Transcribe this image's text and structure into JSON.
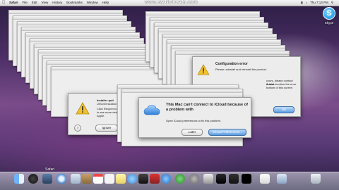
{
  "watermark": {
    "prefix": "www.",
    "brand": "BANDICAM",
    "suffix": ".com"
  },
  "menubar": {
    "apple_icon": "apple-logo-icon",
    "app_name": "Safari",
    "items": [
      "File",
      "Edit",
      "View",
      "History",
      "Bookmarks",
      "Window",
      "Help"
    ],
    "clock": "Thu 7:13 PM"
  },
  "desktop_icon": {
    "label": "Skype",
    "glyph": "S",
    "icon": "skype-icon"
  },
  "installer_dialog": {
    "title": "Installer quit",
    "line1": "UIScreenization",
    "body": [
      "Click Reopen to",
      "to see more deta",
      "Apple."
    ],
    "help": "?",
    "ignore_label": "Ignore"
  },
  "config_dialog": {
    "title": "Configuration error",
    "line1": "Please uninstall and reinstall the product.",
    "fragments": [
      "ccurs, please contact Adobe",
      "it, and mention the error",
      "bottom of this screen"
    ],
    "ok_label": "OK"
  },
  "icloud_dialog": {
    "title_line1": "This Mac can't connect to iCloud because of",
    "title_line2": "a problem with",
    "body": "Open iCloud preferences to fix this problem.",
    "later_label": "Later",
    "prefs_label": "iCloud Preferences...",
    "accent": "#4f93dc"
  },
  "dock": {
    "hover_label": "Safari",
    "app_icons": [
      "finder-icon",
      "dashboard-icon",
      "mission-control-icon",
      "safari-icon",
      "mail-icon",
      "contacts-icon",
      "calendar-icon",
      "reminders-icon",
      "notes-icon",
      "messages-icon",
      "facetime-icon",
      "photo-booth-icon",
      "itunes-icon",
      "app-store-icon",
      "system-preferences-icon",
      "preview-icon",
      "bandicam-icon",
      "activity-monitor-icon",
      "terminal-icon",
      "document-icon",
      "downloads-icon",
      "trash-icon"
    ]
  }
}
